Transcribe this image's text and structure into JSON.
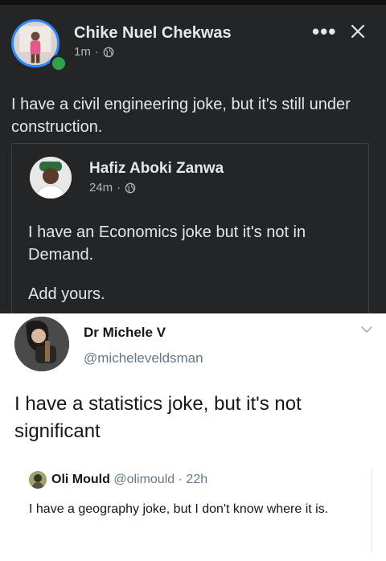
{
  "facebook_post": {
    "author": "Chike Nuel Chekwas",
    "time": "1m",
    "separator": "·",
    "more_label": "•••",
    "text": "I have a civil engineering joke, but it's still under construction.",
    "shared_post": {
      "author": "Hafiz Aboki Zanwa",
      "time": "24m",
      "separator": "·",
      "text": "I have an Economics joke but it's not in Demand.",
      "prompt": "Add yours."
    }
  },
  "tweet": {
    "author": "Dr Michele V",
    "handle": "@micheleveldsman",
    "text": "I have a statistics joke, but it's not significant",
    "quoted_tweet": {
      "author": "Oli Mould",
      "handle": "@olimould",
      "separator": "·",
      "time": "22h",
      "text": "I have a geography joke, but I don't know where it is."
    }
  },
  "colors": {
    "fb_background": "#242526",
    "fb_text": "#e4e6eb",
    "fb_muted": "#b0b3b8",
    "online": "#31a24c",
    "tw_text": "#14171a",
    "tw_muted": "#657786"
  },
  "icons": [
    "globe-icon",
    "more-icon",
    "close-icon",
    "chevron-down-icon"
  ]
}
